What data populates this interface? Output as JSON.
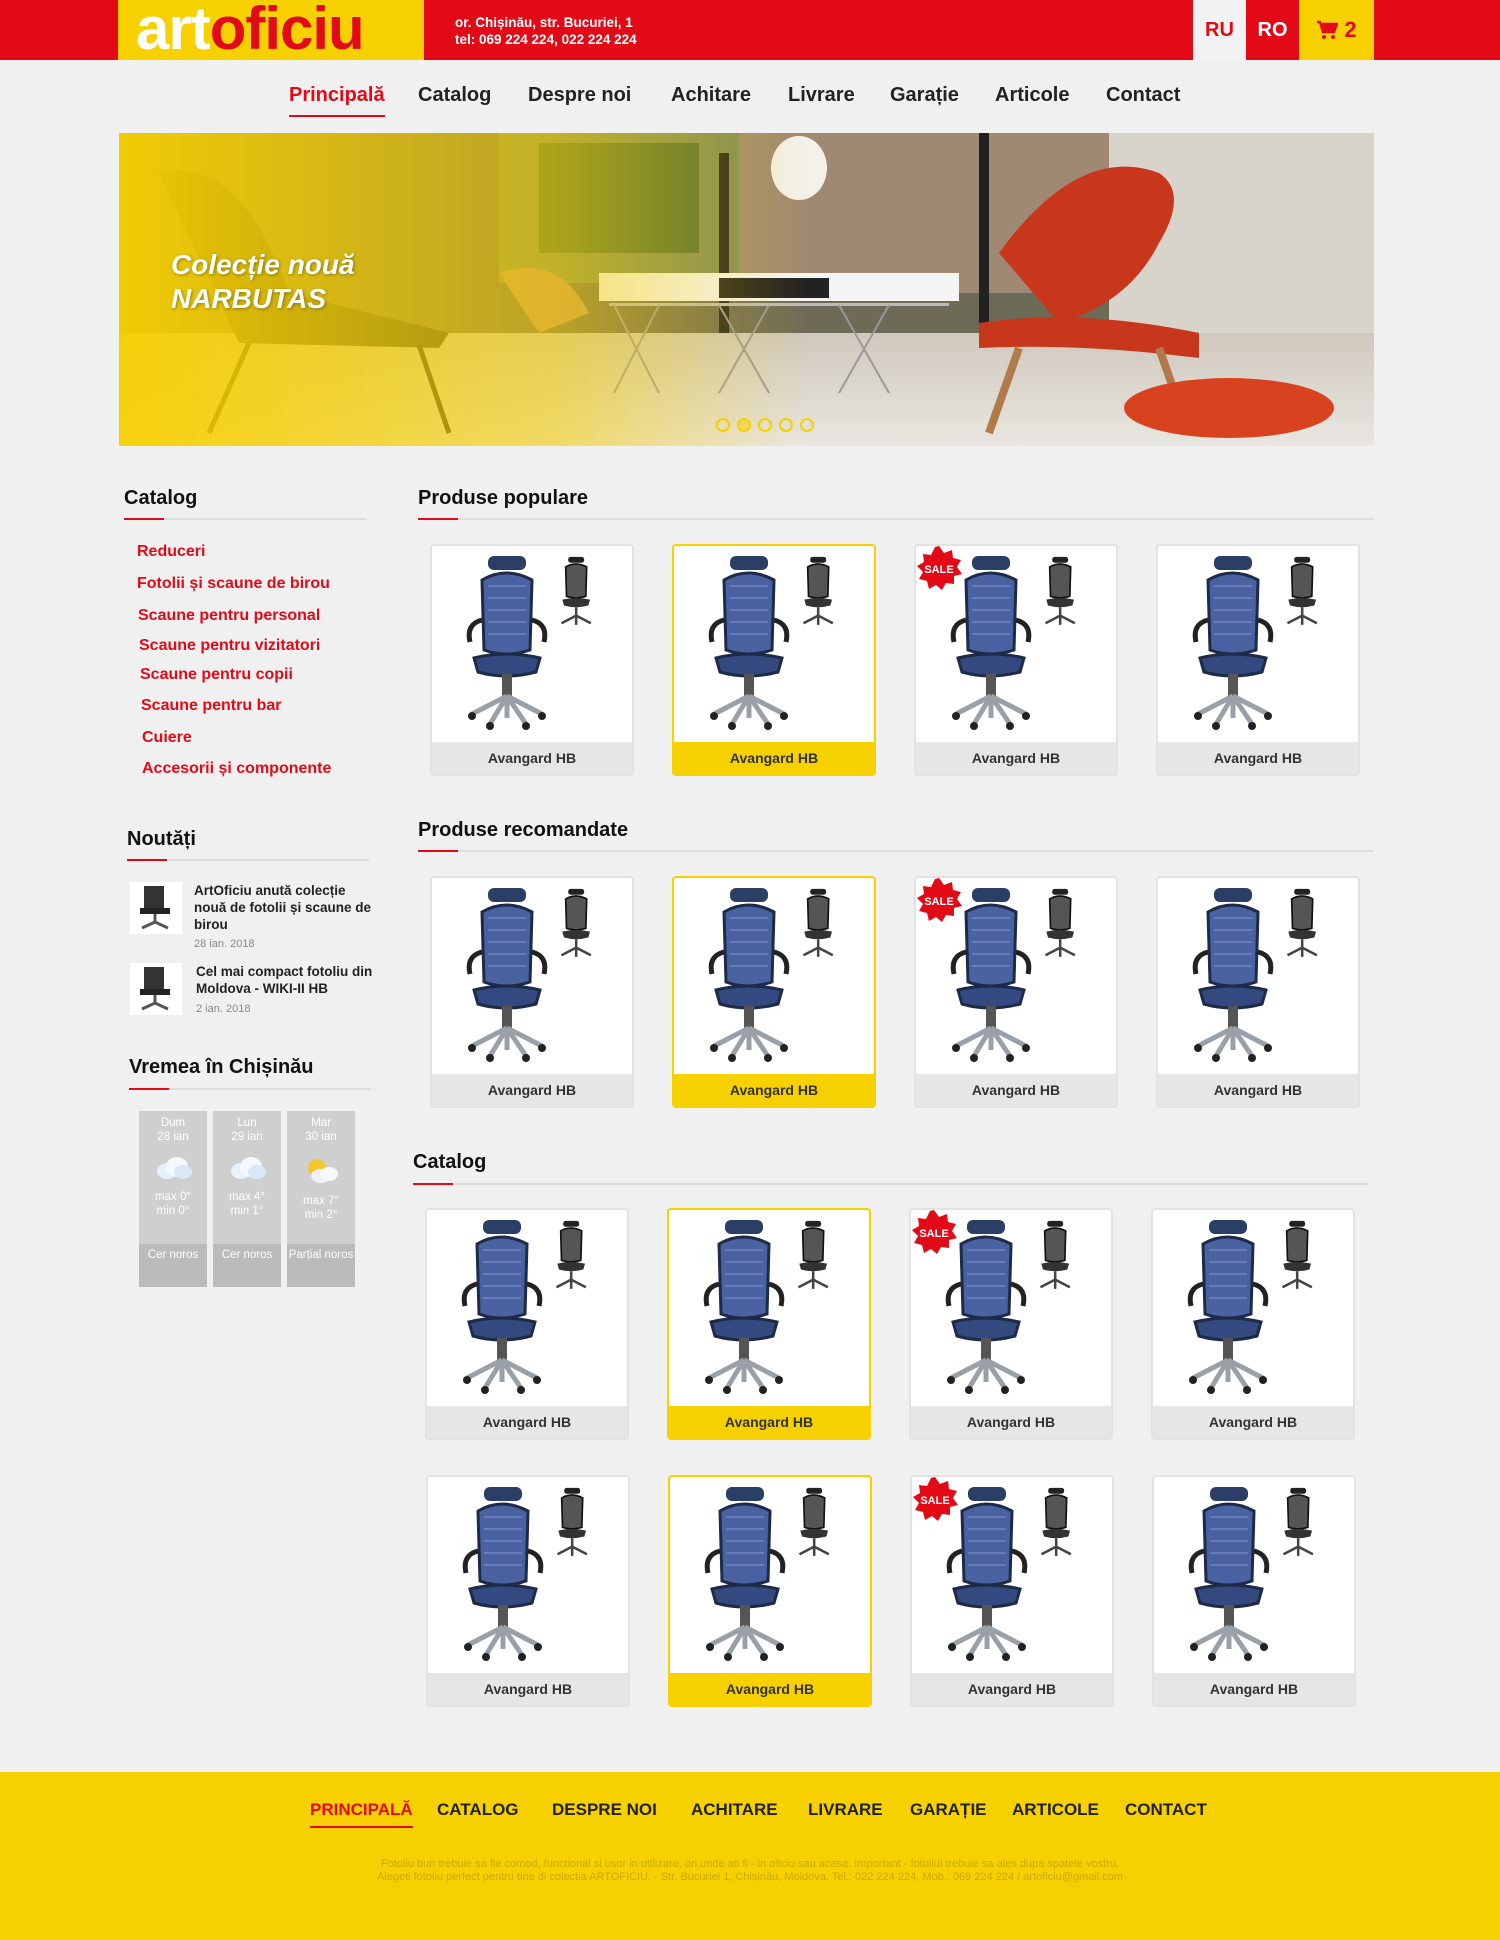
{
  "header": {
    "logo_art": "art",
    "logo_oficiu": "oficiu",
    "address_line1": "or. Chișinău, str. Bucuriei, 1",
    "address_line2": "tel: 069 224 224, 022 224 224",
    "lang_ru": "RU",
    "lang_ro": "RO",
    "cart_icon": "cart-icon",
    "cart_count": "2"
  },
  "nav": {
    "items": [
      "Principală",
      "Catalog",
      "Despre noi",
      "Achitare",
      "Livrare",
      "Garație",
      "Articole",
      "Contact"
    ],
    "active_index": 0
  },
  "hero": {
    "title_line1": "Colecție nouă",
    "title_line2": "NARBUTAS",
    "slides": 5,
    "active_slide": 1
  },
  "sidebar": {
    "catalog_title": "Catalog",
    "catalog_items": [
      "Reduceri",
      "Fotolii și scaune de birou",
      "Scaune pentru personal",
      "Scaune pentru vizitatori",
      "Scaune pentru copii",
      "Scaune pentru bar",
      "Cuiere",
      "Accesorii și componente"
    ],
    "news_title": "Noutăți",
    "news": [
      {
        "title": "ArtOficiu anută colecție nouă de fotolii și scaune de birou",
        "date": "28 ian. 2018"
      },
      {
        "title": "Cel mai compact fotoliu din Moldova - WIKI-II HB",
        "date": "2 ian. 2018"
      }
    ],
    "weather_title": "Vremea în Chișinău",
    "weather": [
      {
        "day": "Dum",
        "date": "28 ian",
        "max": "max 0°",
        "min": "min 0°",
        "desc": "Cer noros",
        "icon": "cloud-icon"
      },
      {
        "day": "Lun",
        "date": "29 ian",
        "max": "max 4°",
        "min": "min 1°",
        "desc": "Cer noros",
        "icon": "cloud-icon"
      },
      {
        "day": "Mar",
        "date": "30 ian",
        "max": "max 7°",
        "min": "min 2°",
        "desc": "Parțial noros",
        "icon": "partly-cloudy-icon"
      }
    ]
  },
  "sections": [
    {
      "title": "Produse populare",
      "products": [
        "Avangard HB",
        "Avangard HB",
        "Avangard HB",
        "Avangard HB"
      ]
    },
    {
      "title": "Produse recomandate",
      "products": [
        "Avangard HB",
        "Avangard HB",
        "Avangard HB",
        "Avangard HB"
      ]
    },
    {
      "title": "Catalog",
      "products": [
        "Avangard HB",
        "Avangard HB",
        "Avangard HB",
        "Avangard HB",
        "Avangard HB",
        "Avangard HB",
        "Avangard HB",
        "Avangard HB"
      ]
    }
  ],
  "sale_badge": "SALE",
  "footer": {
    "nav": [
      "PRINCIPALĂ",
      "CATALOG",
      "DESPRE NOI",
      "ACHITARE",
      "LIVRARE",
      "GARAȚIE",
      "ARTICOLE",
      "CONTACT"
    ],
    "text_line1": "Fotoliu bun trebuie sa fie comod, functional si usor in utilizare, ori unde ati fi - in oficiu sau acasa. Important - fotoliul trebuie sa ales dupa spatele vostru.",
    "text_line2": "Alegeti fotoliu perfect pentru tine di colectia ARTOFICIU. - Str. Bucuriei 1, Chișinău, Moldova. Tel.: 022 224 224, Mob.: 069 224 224 / artoficiu@gmail.com"
  },
  "colors": {
    "brand_red": "#e30a17",
    "brand_yellow": "#f7d000"
  }
}
